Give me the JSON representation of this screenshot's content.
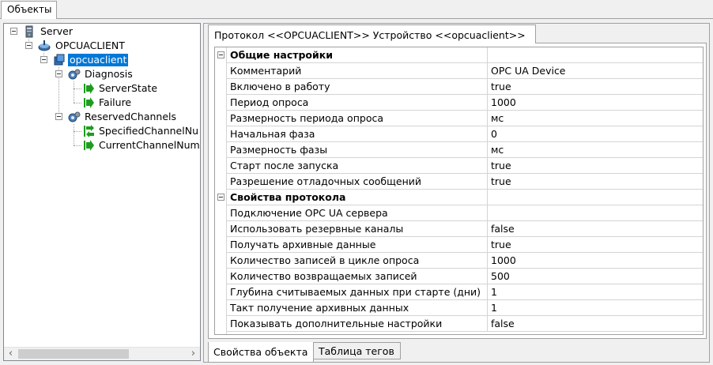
{
  "window": {
    "top_tab": "Объекты"
  },
  "tree": {
    "server": "Server",
    "opcuaclient_group": "OPCUACLIENT",
    "device": "opcuaclient",
    "diagnosis": "Diagnosis",
    "server_state": "ServerState",
    "failure": "Failure",
    "reserved_channels": "ReservedChannels",
    "specified_channel": "SpecifiedChannelNu",
    "current_channel": "CurrentChannelNum"
  },
  "properties": {
    "tab_title": "Протокол <<OPCUACLIENT>> Устройство <<opcuaclient>>",
    "general_header": "Общие настройки",
    "general": [
      {
        "name": "Комментарий",
        "value": "OPC UA Device"
      },
      {
        "name": "Включено в работу",
        "value": "true"
      },
      {
        "name": "Период опроса",
        "value": "1000"
      },
      {
        "name": "Размерность периода опроса",
        "value": "мс"
      },
      {
        "name": "Начальная фаза",
        "value": "0"
      },
      {
        "name": "Размерность фазы",
        "value": "мс"
      },
      {
        "name": "Старт после запуска",
        "value": "true"
      },
      {
        "name": "Разрешение отладочных сообщений",
        "value": "true"
      }
    ],
    "protocol_header": "Свойства протокола",
    "protocol": [
      {
        "name": "Подключение OPC UA сервера",
        "value": ""
      },
      {
        "name": "Использовать резервные каналы",
        "value": "false"
      },
      {
        "name": "Получать архивные данные",
        "value": "true"
      },
      {
        "name": "Количество записей в цикле опроса",
        "value": "1000"
      },
      {
        "name": "Количество возвращаемых записей",
        "value": "500"
      },
      {
        "name": "Глубина считываемых данных при старте (дни)",
        "value": "1"
      },
      {
        "name": "Такт получение архивных данных",
        "value": "1"
      },
      {
        "name": "Показывать дополнительные настройки",
        "value": "false"
      }
    ]
  },
  "bottom_tabs": {
    "object_properties": "Свойства объекта",
    "tag_table": "Таблица тегов"
  },
  "icons": {
    "server": "server-icon",
    "group": "network-icon",
    "device": "device-icon",
    "folder": "gear-folder-icon",
    "tag": "green-arrow-tag-icon"
  },
  "colors": {
    "selection": "#0078d7",
    "tag_arrow": "#1e9c1e"
  }
}
